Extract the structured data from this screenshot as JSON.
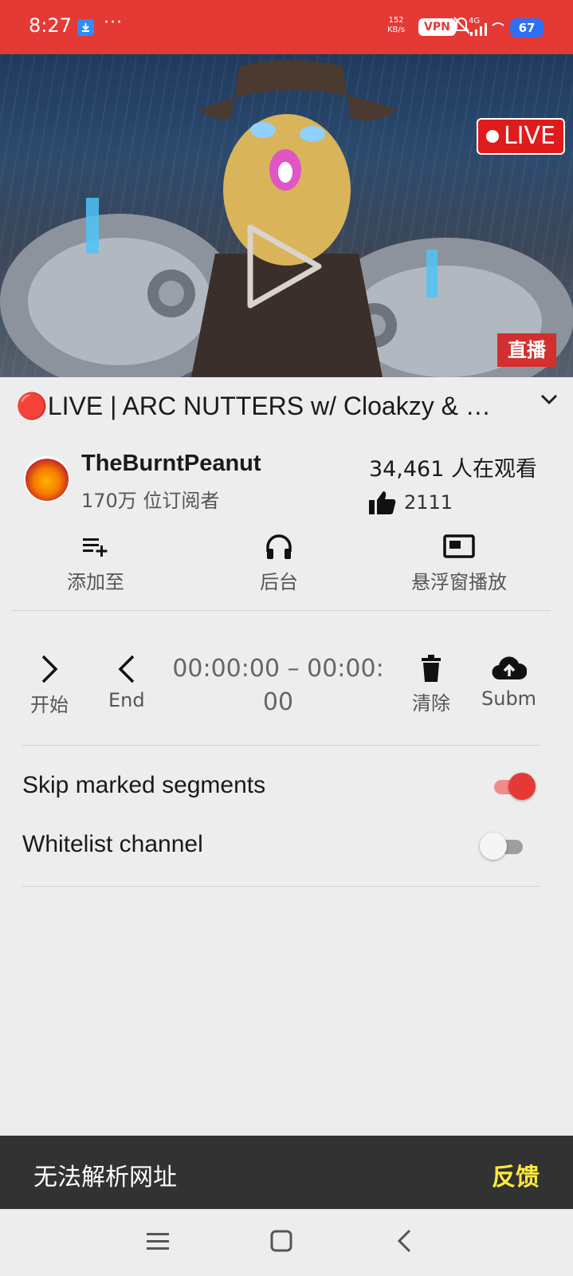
{
  "status_bar": {
    "time": "8:27",
    "dots": "···",
    "speed_value": "152",
    "speed_unit": "KB/s",
    "vpn": "VPN",
    "network": "4G",
    "battery": "67"
  },
  "video": {
    "live_badge": "LIVE",
    "zhibo_badge": "直播"
  },
  "title": "🔴LIVE | ARC NUTTERS w/ Cloakzy & …",
  "channel": {
    "name": "TheBurntPeanut",
    "subscribers": "170万 位订阅者",
    "viewers": "34,461 人在观看",
    "likes": "2111"
  },
  "actions": {
    "add_to": "添加至",
    "background": "后台",
    "popup": "悬浮窗播放"
  },
  "segments": {
    "start": "开始",
    "end": "End",
    "time_range": "00:00:00 – 00:00:00",
    "clear": "清除",
    "submit": "Subm"
  },
  "toggles": {
    "skip_label": "Skip marked segments",
    "skip_on": true,
    "whitelist_label": "Whitelist channel",
    "whitelist_on": false
  },
  "snackbar": {
    "message": "无法解析网址",
    "action": "反馈"
  },
  "colors": {
    "accent": "#e53935",
    "snack_action": "#ffeb3b"
  }
}
